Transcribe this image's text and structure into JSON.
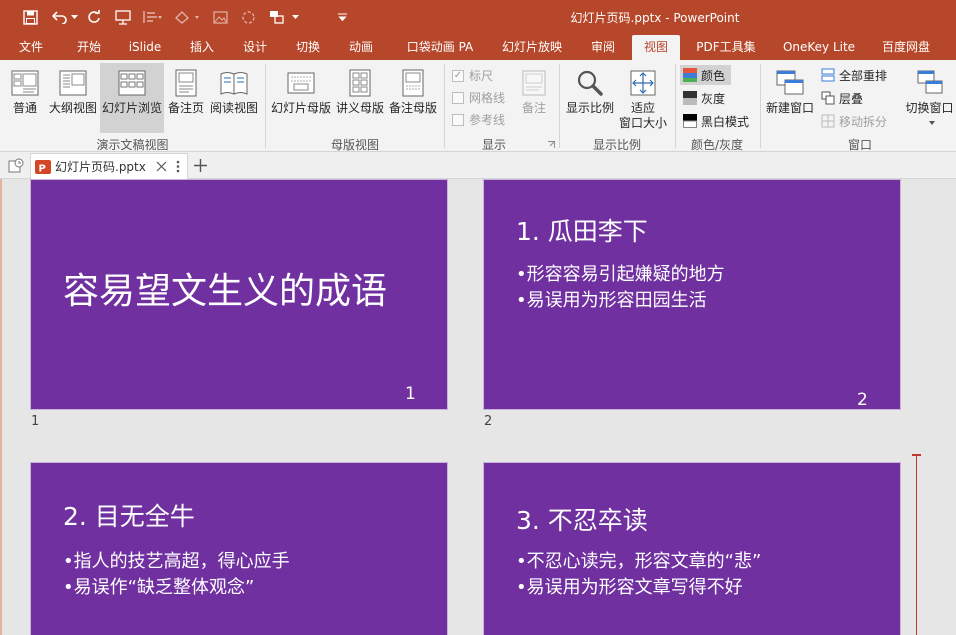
{
  "window": {
    "title": "幻灯片页码.pptx - PowerPoint",
    "accent_color": "#b7472a"
  },
  "quick_access": [
    "save-icon",
    "undo-icon",
    "redo-icon",
    "present-icon",
    "format-icon",
    "shapes-icon",
    "picture-icon",
    "loop-icon",
    "arrange-icon",
    "customize-icon"
  ],
  "tabs": [
    "文件",
    "开始",
    "iSlide",
    "插入",
    "设计",
    "切换",
    "动画",
    "口袋动画 PA",
    "幻灯片放映",
    "审阅",
    "视图",
    "PDF工具集",
    "OneKey Lite",
    "百度网盘"
  ],
  "active_tab": "视图",
  "ribbon": {
    "presentation_views": {
      "label": "演示文稿视图",
      "buttons": [
        "普通",
        "大纲视图",
        "幻灯片浏览",
        "备注页",
        "阅读视图"
      ]
    },
    "master_views": {
      "label": "母版视图",
      "buttons": [
        "幻灯片母版",
        "讲义母版",
        "备注母版"
      ]
    },
    "show": {
      "label": "显示",
      "checks": [
        "标尺",
        "网格线",
        "参考线"
      ],
      "notes_label": "备注"
    },
    "zoom": {
      "label": "显示比例",
      "zoom_button": "显示比例",
      "fit_line1": "适应",
      "fit_line2": "窗口大小"
    },
    "color": {
      "label": "颜色/灰度",
      "options": [
        "颜色",
        "灰度",
        "黑白模式"
      ]
    },
    "window": {
      "label": "窗口",
      "new_window": "新建窗口",
      "arrange_all": "全部重排",
      "cascade": "层叠",
      "move_split": "移动拆分",
      "switch": "切换窗口"
    }
  },
  "doc_tab": {
    "label": "幻灯片页码.pptx"
  },
  "slides": [
    {
      "number": "1",
      "title": "容易望文生义的成语",
      "bullets": [],
      "page": "1"
    },
    {
      "number": "2",
      "title": "1. 瓜田李下",
      "bullets": [
        "•形容容易引起嫌疑的地方",
        "•易误用为形容田园生活"
      ],
      "page": "2"
    },
    {
      "number": "",
      "title": "2. 目无全牛",
      "bullets": [
        "•指人的技艺高超，得心应手",
        "•易误作“缺乏整体观念”"
      ],
      "page": ""
    },
    {
      "number": "",
      "title": "3. 不忍卒读",
      "bullets": [
        "•不忍心读完，形容文章的“悲”",
        "•易误用为形容文章写得不好"
      ],
      "page": ""
    }
  ],
  "slide_color": "#7030a0"
}
